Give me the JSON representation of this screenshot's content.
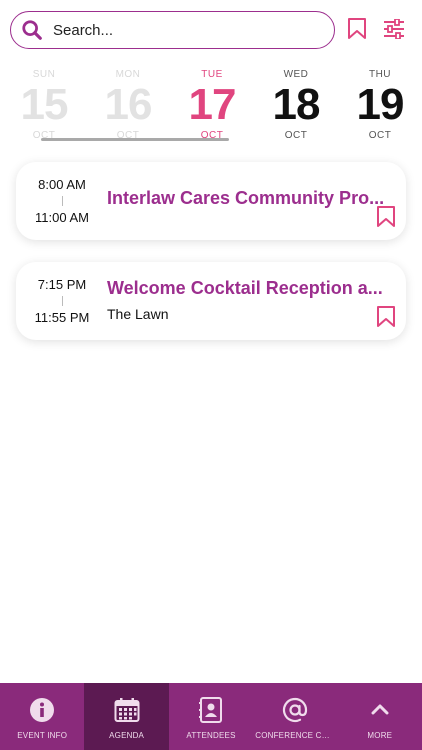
{
  "search": {
    "placeholder": "Search..."
  },
  "days": [
    {
      "dow": "SUN",
      "num": "15",
      "mon": "OCT",
      "state": "past"
    },
    {
      "dow": "MON",
      "num": "16",
      "mon": "OCT",
      "state": "past"
    },
    {
      "dow": "TUE",
      "num": "17",
      "mon": "OCT",
      "state": "active"
    },
    {
      "dow": "WED",
      "num": "18",
      "mon": "OCT",
      "state": "future"
    },
    {
      "dow": "THU",
      "num": "19",
      "mon": "OCT",
      "state": "future"
    }
  ],
  "events": [
    {
      "start": "8:00 AM",
      "end": "11:00 AM",
      "title": "Interlaw Cares Community Pro...",
      "location": ""
    },
    {
      "start": "7:15 PM",
      "end": "11:55 PM",
      "title": "Welcome Cocktail Reception a...",
      "location": "The Lawn"
    }
  ],
  "nav": [
    {
      "label": "EVENT INFO",
      "icon": "info-icon"
    },
    {
      "label": "AGENDA",
      "icon": "calendar-icon"
    },
    {
      "label": "ATTENDEES",
      "icon": "contacts-icon"
    },
    {
      "label": "CONFERENCE CONT...",
      "icon": "at-icon"
    },
    {
      "label": "MORE",
      "icon": "chevron-up-icon"
    }
  ],
  "colors": {
    "brand": "#9c2e8e",
    "accent": "#e0457f",
    "nav_bg": "#8a2a7b",
    "nav_active": "#5c1a52"
  }
}
